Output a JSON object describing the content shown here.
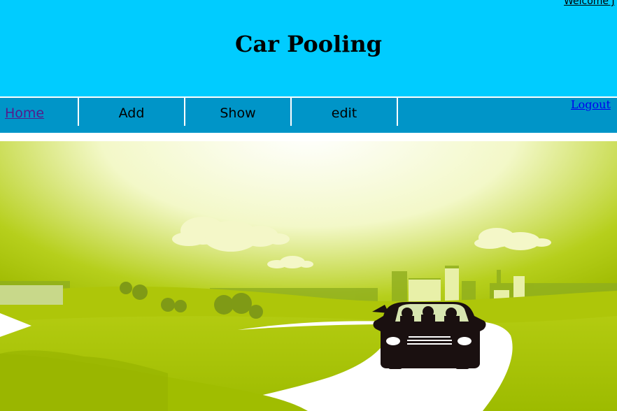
{
  "header": {
    "welcome_text": "Welcome J",
    "title": "Car Pooling"
  },
  "nav": {
    "items": [
      {
        "label": "Home"
      },
      {
        "label": "Add"
      },
      {
        "label": "Show"
      },
      {
        "label": "edit"
      }
    ],
    "logout_label": "Logout"
  },
  "banner": {
    "illustration": "car-pooling-road-scene",
    "colors": {
      "header_bg": "#00ccff",
      "nav_bg": "#0095c8",
      "grass": "#a9c400",
      "car": "#1a1010"
    }
  }
}
